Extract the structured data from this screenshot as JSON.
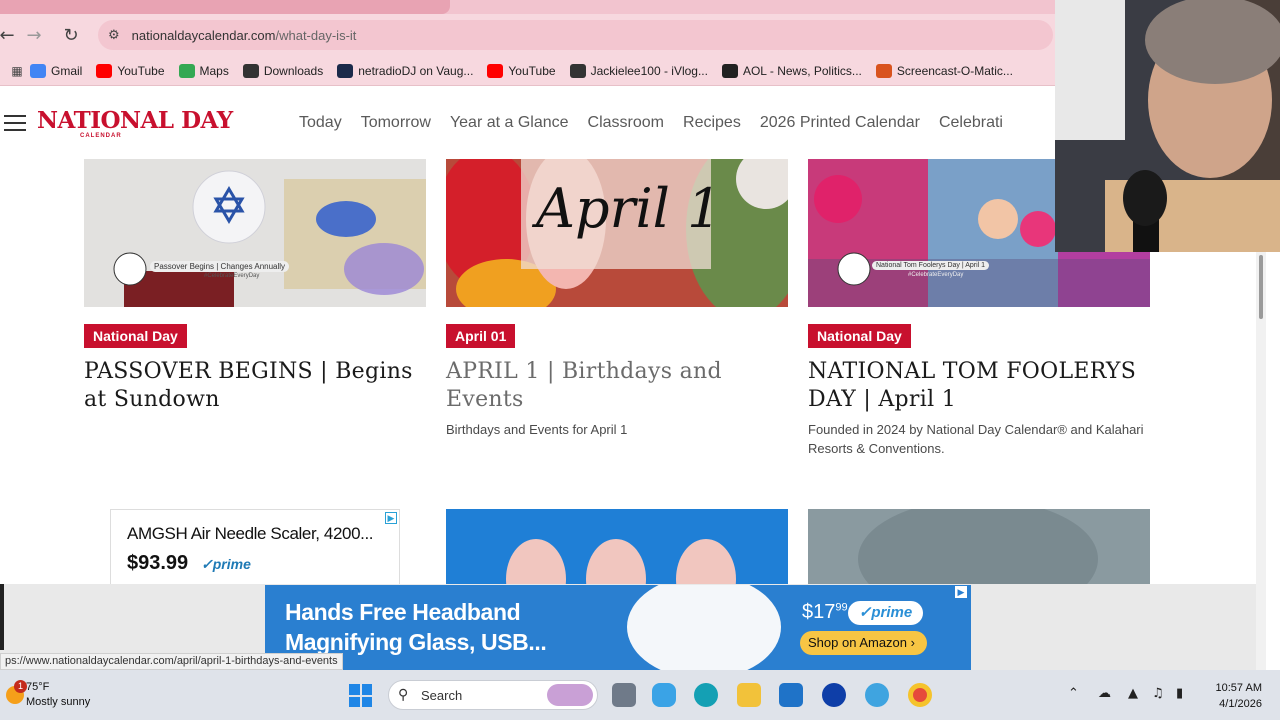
{
  "browser": {
    "url_domain": "nationaldaycalendar.com",
    "url_path": "/what-day-is-it",
    "bookmarks": [
      {
        "label": "Gmail",
        "icon": "google-icon",
        "color": "#4285f4"
      },
      {
        "label": "YouTube",
        "icon": "youtube-icon",
        "color": "#ff0000"
      },
      {
        "label": "Maps",
        "icon": "maps-icon",
        "color": "#34a853"
      },
      {
        "label": "Downloads",
        "icon": "download-icon",
        "color": "#333333"
      },
      {
        "label": "netradioDJ on Vaug...",
        "icon": "vaughn-icon",
        "color": "#1b2a4a"
      },
      {
        "label": "YouTube",
        "icon": "youtube-icon",
        "color": "#ff0000"
      },
      {
        "label": "Jackielee100 - iVlog...",
        "icon": "ivlog-icon",
        "color": "#333333"
      },
      {
        "label": "AOL - News, Politics...",
        "icon": "aol-icon",
        "color": "#222222"
      },
      {
        "label": "Screencast-O-Matic...",
        "icon": "screencast-icon",
        "color": "#d9531e"
      }
    ],
    "status_url": "ps://www.nationaldaycalendar.com/april/april-1-birthdays-and-events"
  },
  "site": {
    "logo_text": "NATIONAL DAY",
    "logo_sub": "CALENDAR",
    "nav": [
      "Today",
      "Tomorrow",
      "Year at a Glance",
      "Classroom",
      "Recipes",
      "2026 Printed Calendar",
      "Celebrati"
    ]
  },
  "cards": [
    {
      "badge": "National Day",
      "title": "PASSOVER BEGINS | Begins at Sundown",
      "description": "",
      "image_caption": "Passover Begins | Changes Annually",
      "image_hashtag": "#CelebrateEveryDay"
    },
    {
      "badge": "April 01",
      "title": "APRIL 1 | Birthdays and Events",
      "description": "Birthdays and Events for April 1",
      "image_caption": "April 1"
    },
    {
      "badge": "National Day",
      "title": "NATIONAL TOM FOOLERYS DAY | April 1",
      "description": "Founded in 2024 by National Day Calendar® and Kalahari Resorts & Conventions.",
      "image_caption": "National Tom Foolerys Day | April 1",
      "image_hashtag": "#CelebrateEveryDay"
    }
  ],
  "ad_small": {
    "title": "AMGSH Air Needle Scaler, 4200...",
    "price": "$93.99",
    "prime": "prime"
  },
  "ad_banner": {
    "title_line1": "Hands Free Headband",
    "title_line2": "Magnifying Glass, USB...",
    "price_dollars": "$17",
    "price_cents": "99",
    "prime": "prime",
    "cta": "Shop on Amazon"
  },
  "taskbar": {
    "weather_temp": "75°F",
    "weather_cond": "Mostly sunny",
    "weather_alert": "1",
    "search_label": "Search",
    "time": "10:57 AM",
    "date": "4/1/2026"
  }
}
